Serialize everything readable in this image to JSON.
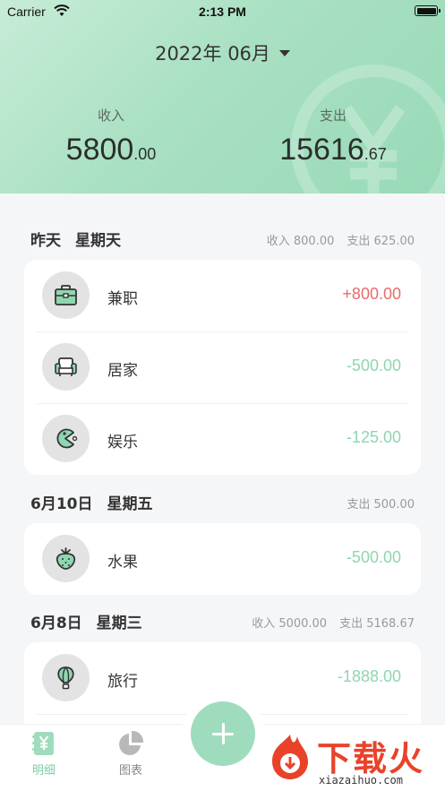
{
  "status_bar": {
    "carrier": "Carrier",
    "time": "2:13 PM"
  },
  "header": {
    "month": "2022年 06月",
    "income_label": "收入",
    "income_int": "5800",
    "income_dec": ".00",
    "expense_label": "支出",
    "expense_int": "15616",
    "expense_dec": ".67"
  },
  "sections": [
    {
      "date": "昨天",
      "weekday": "星期天",
      "income_summary": "收入 800.00",
      "expense_summary": "支出 625.00",
      "items": [
        {
          "icon": "briefcase-icon",
          "label": "兼职",
          "amount": "+800.00"
        },
        {
          "icon": "sofa-icon",
          "label": "居家",
          "amount": "-500.00"
        },
        {
          "icon": "pacman-icon",
          "label": "娱乐",
          "amount": "-125.00"
        }
      ]
    },
    {
      "date": "6月10日",
      "weekday": "星期五",
      "expense_summary": "支出 500.00",
      "items": [
        {
          "icon": "strawberry-icon",
          "label": "水果",
          "amount": "-500.00"
        }
      ]
    },
    {
      "date": "6月8日",
      "weekday": "星期三",
      "income_summary": "收入 5000.00",
      "expense_summary": "支出 5168.67",
      "items": [
        {
          "icon": "hot-air-balloon-icon",
          "label": "旅行",
          "amount": "-1888.00"
        }
      ]
    }
  ],
  "tabbar": {
    "tab_detail": "明细",
    "tab_chart": "图表"
  },
  "watermark": {
    "text": "下载火",
    "url": "xiazaihuo.com"
  },
  "colors": {
    "accent": "#9fdcbd",
    "income": "#e86c6c",
    "expense": "#8fd6b0"
  }
}
